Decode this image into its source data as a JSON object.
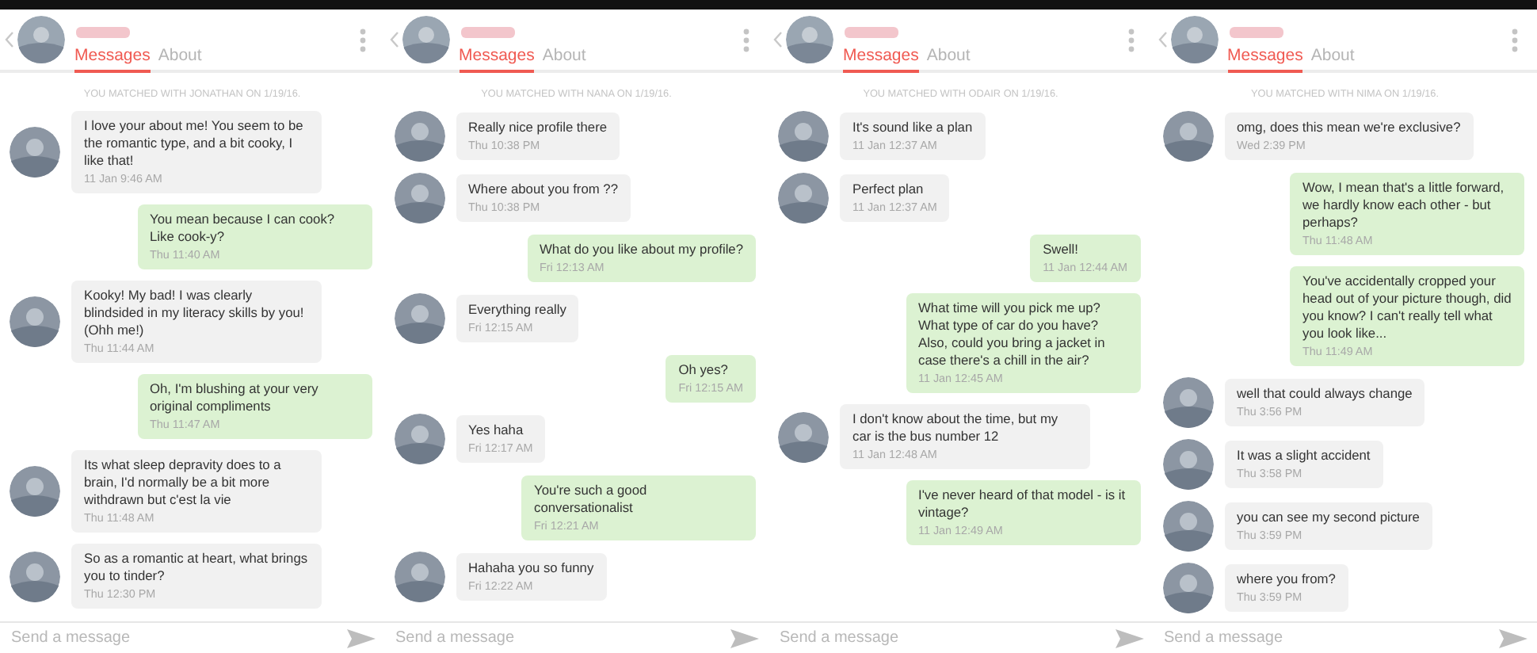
{
  "panels": [
    {
      "tabs": [
        {
          "label": "Messages",
          "selected": true
        },
        {
          "label": "About",
          "selected": false
        }
      ],
      "match_note": "YOU MATCHED WITH JONATHAN ON 1/19/16.",
      "messages": [
        {
          "kind": "received",
          "text": "I love your about me! You seem to be the romantic type, and a bit cooky, I like that!",
          "time": "11 Jan 9:46 AM"
        },
        {
          "kind": "sent",
          "text": "You mean because I can cook? Like cook-y?",
          "time": "Thu 11:40 AM"
        },
        {
          "kind": "received",
          "text": "Kooky! My bad! I was clearly blindsided in my literacy skills by you! (Ohh me!)",
          "time": "Thu 11:44 AM"
        },
        {
          "kind": "sent",
          "text": "Oh, I'm blushing at your very original compliments",
          "time": "Thu 11:47 AM"
        },
        {
          "kind": "received",
          "text": "Its what sleep depravity does to a brain, I'd normally be a bit more withdrawn but c'est la vie",
          "time": "Thu 11:48 AM"
        },
        {
          "kind": "received",
          "text": "So as a romantic at heart, what brings you to tinder?",
          "time": "Thu 12:30 PM"
        }
      ],
      "placeholder": "Send a message"
    },
    {
      "tabs": [
        {
          "label": "Messages",
          "selected": true
        },
        {
          "label": "About",
          "selected": false
        }
      ],
      "match_note": "YOU MATCHED WITH NANA ON 1/19/16.",
      "messages": [
        {
          "kind": "received",
          "text": "Really nice profile there",
          "time": "Thu 10:38 PM"
        },
        {
          "kind": "received",
          "text": "Where about you from ??",
          "time": "Thu 10:38 PM"
        },
        {
          "kind": "sent",
          "text": "What do you like about my profile?",
          "time": "Fri 12:13 AM"
        },
        {
          "kind": "received",
          "text": "Everything really",
          "time": "Fri 12:15 AM"
        },
        {
          "kind": "sent",
          "text": "Oh yes?",
          "time": "Fri 12:15 AM"
        },
        {
          "kind": "received",
          "text": "Yes haha",
          "time": "Fri 12:17 AM"
        },
        {
          "kind": "sent",
          "text": "You're such a good conversationalist",
          "time": "Fri 12:21 AM"
        },
        {
          "kind": "received",
          "text": "Hahaha you so funny",
          "time": "Fri 12:22 AM"
        }
      ],
      "placeholder": "Send a message"
    },
    {
      "tabs": [
        {
          "label": "Messages",
          "selected": true
        },
        {
          "label": "About",
          "selected": false
        }
      ],
      "match_note": "YOU MATCHED WITH ODAIR ON 1/19/16.",
      "messages": [
        {
          "kind": "received",
          "text": "It's sound like a plan",
          "time": "11 Jan 12:37 AM"
        },
        {
          "kind": "received",
          "text": "Perfect plan",
          "time": "11 Jan 12:37 AM"
        },
        {
          "kind": "sent",
          "text": "Swell!",
          "time": "11 Jan 12:44 AM"
        },
        {
          "kind": "sent",
          "text": "What time will you pick me up? What type of car do you have? Also, could you bring a jacket in case there's a chill in the air?",
          "time": "11 Jan 12:45 AM"
        },
        {
          "kind": "received",
          "text": "I don't know about the time, but my car is the bus number 12",
          "time": "11 Jan 12:48 AM"
        },
        {
          "kind": "sent",
          "text": "I've never heard of that model - is it vintage?",
          "time": "11 Jan 12:49 AM"
        }
      ],
      "placeholder": "Send a message"
    },
    {
      "tabs": [
        {
          "label": "Messages",
          "selected": true
        },
        {
          "label": "About",
          "selected": false
        }
      ],
      "match_note": "YOU MATCHED WITH NIMA ON 1/19/16.",
      "messages": [
        {
          "kind": "received",
          "text": "omg, does this mean we're exclusive?",
          "time": "Wed 2:39 PM"
        },
        {
          "kind": "sent",
          "text": "Wow, I mean that's a little forward, we hardly know each other - but perhaps?",
          "time": "Thu 11:48 AM"
        },
        {
          "kind": "sent",
          "text": "You've accidentally cropped your head out of your picture though, did you know? I can't really tell what you look like...",
          "time": "Thu 11:49 AM"
        },
        {
          "kind": "received",
          "text": "well that could always change",
          "time": "Thu 3:56 PM"
        },
        {
          "kind": "received",
          "text": "It was a slight accident",
          "time": "Thu 3:58 PM"
        },
        {
          "kind": "received",
          "text": "you can see my second picture",
          "time": "Thu 3:59 PM"
        },
        {
          "kind": "received",
          "text": "where you from?",
          "time": "Thu 3:59 PM"
        }
      ],
      "placeholder": "Send a message"
    }
  ]
}
